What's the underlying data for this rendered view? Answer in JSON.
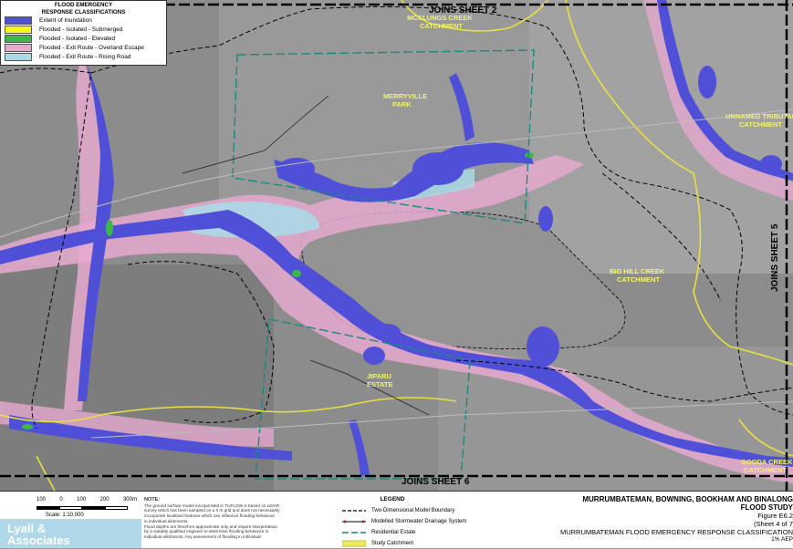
{
  "legend": {
    "title_line1": "FLOOD EMERGENCY",
    "title_line2": "RESPONSE CLASSIFICATIONS",
    "items": [
      {
        "label": "Extent of Inundation",
        "color": "#4f4fd8"
      },
      {
        "label": "Flooded - Isolated - Submerged",
        "color": "#f7f71a"
      },
      {
        "label": "Flooded - Isolated - Elevated",
        "color": "#3cb84a"
      },
      {
        "label": "Flooded - Exit Route - Overland Escape",
        "color": "#e8a8d0"
      },
      {
        "label": "Flooded - Exit Route - Rising Road",
        "color": "#a8dce8"
      }
    ]
  },
  "map_labels": {
    "joins_top": "JOINS SHEET 2",
    "joins_bottom": "JOINS SHEET 6",
    "joins_right": "JOINS SHEET 5",
    "mcclungs_1": "MCCLUNGS CREEK",
    "mcclungs_2": "CATCHMENT",
    "merryville_1": "MERRYVILLE",
    "merryville_2": "PARK",
    "unnamed_1": "UNNAMED TRIBUTARY",
    "unnamed_2": "CATCHMENT",
    "bighill_1": "BIG HILL CREEK",
    "bighill_2": "CATCHMENT",
    "jiparu_1": "JIPARU",
    "jiparu_2": "ESTATE",
    "gooda_1": "GOODA CREEK",
    "gooda_2": "CATCHMENT"
  },
  "scale": {
    "ticks": [
      "100",
      "0",
      "100",
      "200",
      "300m"
    ],
    "label": "Scale: 1:10,000"
  },
  "note": {
    "heading": "NOTE:",
    "lines": [
      "The ground surface model incorporated in TUFLOW is based on LiDAR",
      "survey which has been sampled on a 3 m grid and does not necessarily",
      "incorporate localised features which can influence flooding behaviour",
      "in individual allotments.",
      "Flood depths are therefore approximate only and require interpretation",
      "by a suitably qualified engineer to determine flooding behaviour in",
      "individual allotments. Any assessment of flooding in individual"
    ]
  },
  "legend2": {
    "title": "LEGEND",
    "items": [
      "Two-Dimensional Model Boundary",
      "Modelled Stormwater Drainage System",
      "Residential Estate",
      "Study Catchment"
    ]
  },
  "title_block": {
    "line1": "MURRUMBATEMAN, BOWNING, BOOKHAM AND BINALONG",
    "line2": "FLOOD STUDY",
    "line3": "Figure E6.2",
    "line4": "(Sheet 4 of 7",
    "line5": "MURRUMBATEMAN FLOOD EMERGENCY RESPONSE CLASSIFICATION",
    "line6": "1% AEP"
  },
  "logo": {
    "line1": "Lyall &",
    "line2": "Associates"
  }
}
